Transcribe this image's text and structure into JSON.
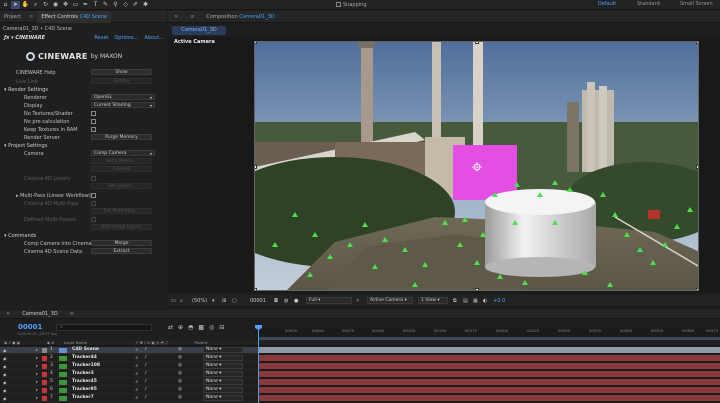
{
  "toolbar": {
    "snapping_label": "Snapping",
    "workspaces": [
      "Default",
      "Standard",
      "Small Screen"
    ],
    "active_workspace": "Default"
  },
  "left_panel": {
    "tab_project": "Project",
    "tab_effect_prefix": "Effect Controls",
    "tab_effect_layer": "C4D Scene",
    "breadcrumb": "Camera01_3D • C4D Scene",
    "fx_name": "CINEWARE",
    "fx_links": [
      "Reset",
      "Options...",
      "About..."
    ],
    "logo_word": "CINEWARE",
    "logo_by": "by MAXON",
    "help_label": "CINEWARE Help",
    "help_button": "Show",
    "live_link_label": "Live Link",
    "live_link_button": "Enable",
    "render_settings": "Render Settings",
    "renderer_label": "Renderer",
    "renderer_value": "OpenGL",
    "display_label": "Display",
    "display_value": "Current Shading",
    "no_textures_label": "No Textures/Shader",
    "no_precalc_label": "No pre-calculation",
    "keep_textures_label": "Keep Textures in RAM",
    "render_server_label": "Render Server",
    "render_server_button": "Purge Memory",
    "project_settings": "Project Settings",
    "camera_label": "Camera",
    "camera_value": "Comp Camera",
    "set_camera_button": "Set Camera...",
    "camera_disabled_label": "Camera",
    "cinema_layers_label": "Cinema 4D Layers",
    "set_layers_button": "Set Layers...",
    "multipass_label": "Multi-Pass (Linear Workflow)",
    "c4d_multipass_label": "Cinema 4D Multi-Pass",
    "set_multipass_button": "Set Multi-Pass...",
    "defined_multipasses_label": "Defined Multi-Passes",
    "add_image_layers_button": "Add Image Layers",
    "commands": "Commands",
    "comp_camera_label": "Comp Camera into Cinema",
    "comp_camera_button": "Merge",
    "scene_data_label": "Cinema 4D Scene Data",
    "scene_data_button": "Extract"
  },
  "comp": {
    "tab_prefix": "Composition",
    "tab_name": "Camera01_3D",
    "sub_tab": "Camera01_3D",
    "active_camera": "Active Camera",
    "footer": {
      "zoom": "(50%)",
      "timecode": "00001",
      "resolution": "Full",
      "camera": "Active Camera",
      "views": "1 View",
      "exposure": "+0.0"
    }
  },
  "timeline": {
    "tab_name": "Camera01_3D",
    "timecode": "00001",
    "frames_sub": "0:00:00:01 (29.97 fps)",
    "search_placeholder": "",
    "ticks": [
      "00025",
      "00050",
      "00075",
      "00100",
      "00125",
      "00150",
      "00175",
      "00200",
      "00225",
      "00250",
      "00275",
      "00300",
      "00325",
      "00350",
      "00375",
      "00400"
    ],
    "columns": {
      "layer_name": "Layer Name",
      "parent": "Parent"
    },
    "layers": [
      {
        "num": "1",
        "name": "C4D Scene",
        "parent": "None",
        "color": "#8a8a8a",
        "selected": true
      },
      {
        "num": "2",
        "name": "Tracker44",
        "parent": "None",
        "color": "#c8383a",
        "selected": false
      },
      {
        "num": "3",
        "name": "Tracker108",
        "parent": "None",
        "color": "#c8383a",
        "selected": false
      },
      {
        "num": "4",
        "name": "Tracker3",
        "parent": "None",
        "color": "#c8383a",
        "selected": false
      },
      {
        "num": "5",
        "name": "Tracker45",
        "parent": "None",
        "color": "#c8383a",
        "selected": false
      },
      {
        "num": "6",
        "name": "Tracker95",
        "parent": "None",
        "color": "#c8383a",
        "selected": false
      },
      {
        "num": "7",
        "name": "Tracker7",
        "parent": "None",
        "color": "#c8383a",
        "selected": false
      }
    ]
  }
}
